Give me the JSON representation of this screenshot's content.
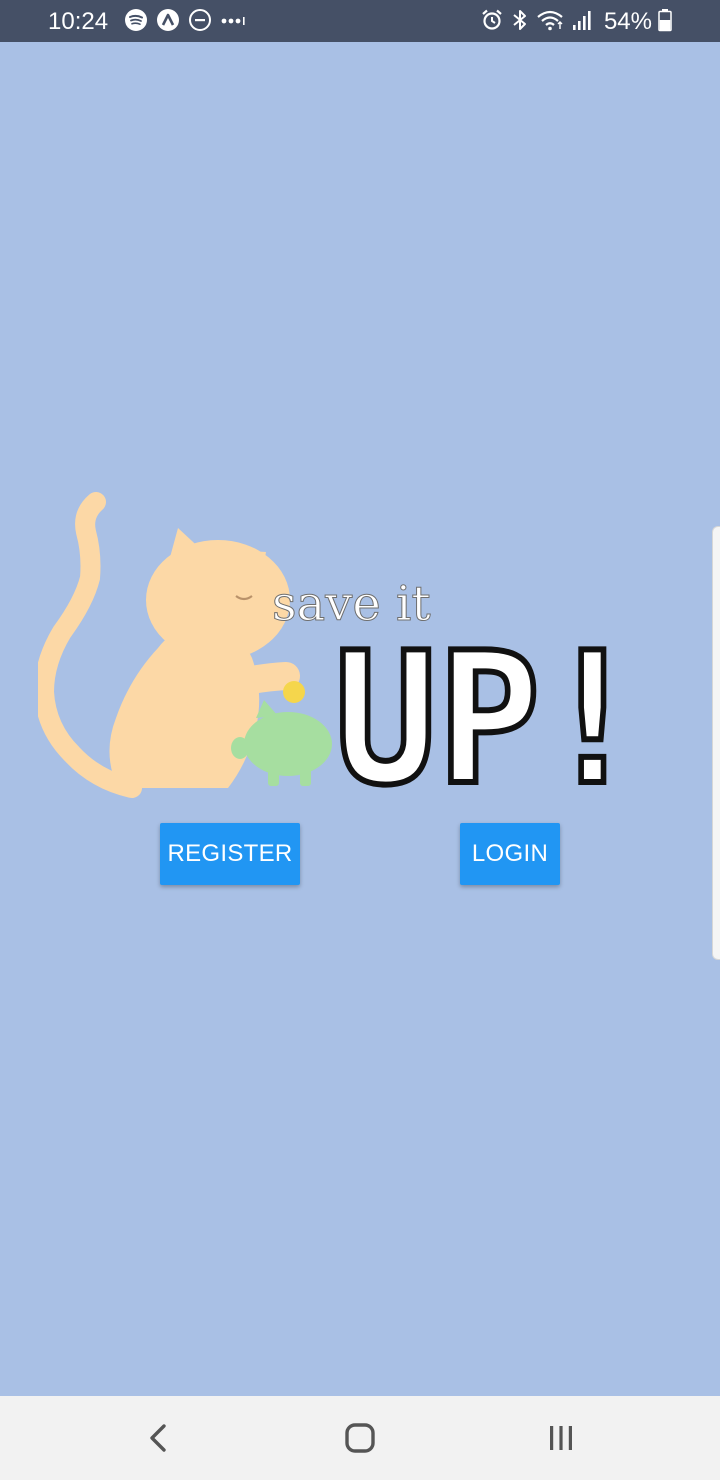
{
  "status_bar": {
    "time": "10:24",
    "battery": "54%",
    "left_icons": [
      "spotify-icon",
      "arrow-up-circle-icon",
      "do-not-disturb-icon",
      "more-dots-icon"
    ],
    "right_icons": [
      "alarm-icon",
      "bluetooth-icon",
      "wifi-icon",
      "signal-icon",
      "battery-icon"
    ]
  },
  "logo": {
    "tagline": "save it",
    "wordmark": "UP!",
    "colors": {
      "cat": "#fcd8a6",
      "piggy": "#a6dea0",
      "coin": "#f5d64c"
    }
  },
  "actions": {
    "register_label": "REGISTER",
    "login_label": "LOGIN"
  },
  "colors": {
    "background": "#a9c0e5",
    "button": "#2196f3",
    "status_bar": "#455066",
    "nav_bar": "#f2f2f2"
  },
  "nav_bar": {
    "icons": [
      "back-icon",
      "home-icon",
      "recents-icon"
    ]
  }
}
